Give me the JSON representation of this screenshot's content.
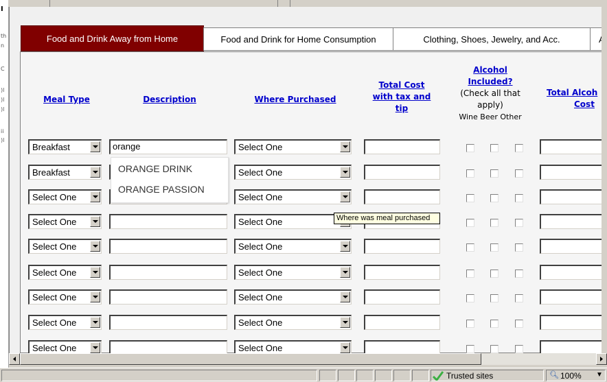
{
  "tabs": [
    {
      "label": "Food and Drink Away from Home"
    },
    {
      "label": "Food and Drink for Home Consumption"
    },
    {
      "label": "Clothing, Shoes, Jewelry, and Acc."
    },
    {
      "label": "A"
    }
  ],
  "headers": {
    "meal_type": "Meal Type",
    "description": "Description",
    "where_purchased": "Where Purchased",
    "total_cost_l1": "Total Cost",
    "total_cost_l2": "with tax and",
    "total_cost_l3": "tip",
    "alcohol_l1": "Alcohol",
    "alcohol_l2": "Included?",
    "alcohol_l3": "(Check all that",
    "alcohol_l4": "apply)",
    "alcohol_sub": "Wine Beer Other",
    "total_alcohol_l1": "Total Alcoh",
    "total_alcohol_l2": "Cost"
  },
  "rows": [
    {
      "meal_type": "Breakfast",
      "description": "orange",
      "where": "Select One"
    },
    {
      "meal_type": "Breakfast",
      "description": "",
      "where": "Select One"
    },
    {
      "meal_type": "Select One",
      "description": "",
      "where": "Select One"
    },
    {
      "meal_type": "Select One",
      "description": "",
      "where": "Select One"
    },
    {
      "meal_type": "Select One",
      "description": "",
      "where": "Select One"
    },
    {
      "meal_type": "Select One",
      "description": "",
      "where": "Select One"
    },
    {
      "meal_type": "Select One",
      "description": "",
      "where": "Select One"
    },
    {
      "meal_type": "Select One",
      "description": "",
      "where": "Select One"
    },
    {
      "meal_type": "Select One",
      "description": "",
      "where": "Select One"
    }
  ],
  "autocomplete": [
    "ORANGE DRINK",
    "ORANGE PASSION"
  ],
  "tooltip": "Where was meal purchased",
  "status": {
    "zone": "Trusted sites",
    "zoom": "100%"
  },
  "colors": {
    "active_tab": "#800000",
    "link": "#0000cc",
    "tooltip_bg": "#ffffe1"
  },
  "icons": [
    "dropdown-arrow-icon",
    "checkmark-icon",
    "zoom-icon",
    "scroll-left-icon",
    "scroll-right-icon"
  ]
}
